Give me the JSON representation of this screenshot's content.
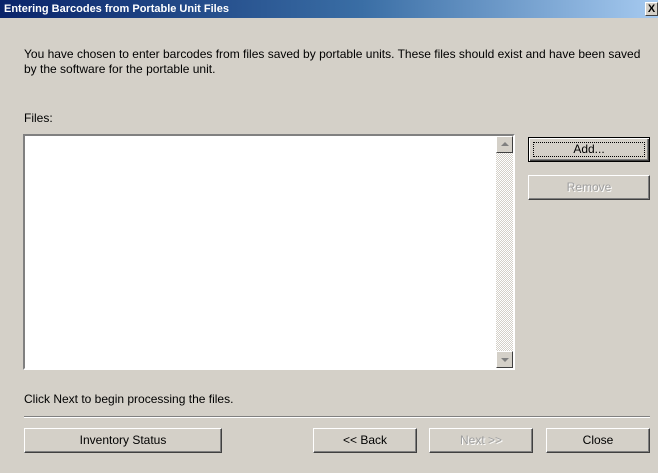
{
  "window": {
    "title": "Entering Barcodes from Portable Unit Files",
    "close_glyph": "X"
  },
  "intro_text": "You have chosen to enter barcodes from files saved by portable units.  These files should exist and have been saved by the software for the portable unit.",
  "files_label": "Files:",
  "files_list": [],
  "buttons": {
    "add": "Add...",
    "remove": "Remove",
    "inventory_status": "Inventory Status",
    "back": "<< Back",
    "next": "Next >>",
    "close": "Close"
  },
  "hint_text": "Click Next to begin processing the files.",
  "icons": {
    "scroll_up": "scroll-up-arrow-icon",
    "scroll_down": "scroll-down-arrow-icon"
  },
  "colors": {
    "title_gradient_start": "#0a246a",
    "title_gradient_end": "#a6caf0",
    "dialog_face": "#d4d0c8",
    "disabled_text": "#a0a0a0"
  }
}
